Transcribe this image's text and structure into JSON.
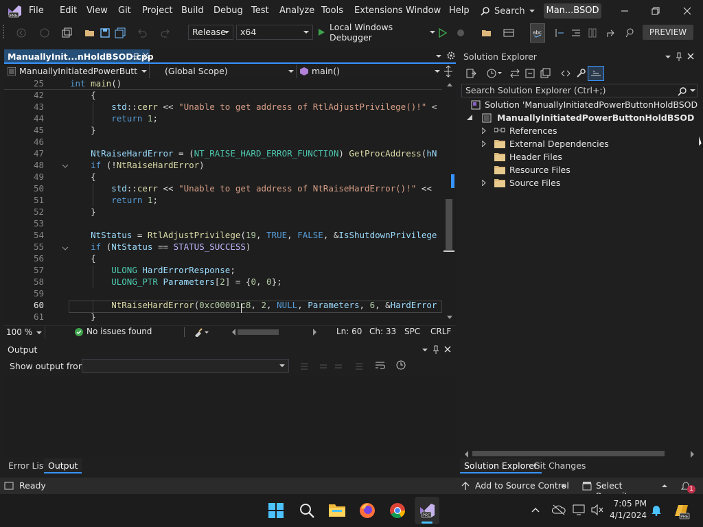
{
  "title": {
    "menu": [
      "File",
      "Edit",
      "View",
      "Git",
      "Project",
      "Build",
      "Debug",
      "Test",
      "Analyze",
      "Tools",
      "Extensions",
      "Window",
      "Help"
    ],
    "search_label": "Search",
    "solution_badge": "Man...BSOD"
  },
  "toolbar": {
    "config": "Release",
    "platform": "x64",
    "debugger": "Local Windows Debugger",
    "preview": "PREVIEW"
  },
  "editor": {
    "tab_label": "ManuallyInit...nHoldBSOD.cpp",
    "nav_project": "ManuallyInitiatedPowerButtonHo",
    "nav_scope": "(Global Scope)",
    "nav_function": "main()",
    "lines": [
      {
        "num": "25",
        "text": "int main()"
      },
      {
        "num": "42",
        "text": "    {"
      },
      {
        "num": "43",
        "text": "        std::cerr << \"Unable to get address of RtlAdjustPrivilege()!\" <"
      },
      {
        "num": "44",
        "text": "        return 1;"
      },
      {
        "num": "45",
        "text": "    }"
      },
      {
        "num": "46",
        "text": ""
      },
      {
        "num": "47",
        "text": "    NtRaiseHardError = (NT_RAISE_HARD_ERROR_FUNCTION) GetProcAddress(hN"
      },
      {
        "num": "48",
        "text": "    if (!NtRaiseHardError)"
      },
      {
        "num": "49",
        "text": "    {"
      },
      {
        "num": "50",
        "text": "        std::cerr << \"Unable to get address of NtRaiseHardError()!\" <<"
      },
      {
        "num": "51",
        "text": "        return 1;"
      },
      {
        "num": "52",
        "text": "    }"
      },
      {
        "num": "53",
        "text": ""
      },
      {
        "num": "54",
        "text": "    NtStatus = RtlAdjustPrivilege(19, TRUE, FALSE, &IsShutdownPrivilege"
      },
      {
        "num": "55",
        "text": "    if (NtStatus == STATUS_SUCCESS)"
      },
      {
        "num": "56",
        "text": "    {"
      },
      {
        "num": "57",
        "text": "        ULONG HardErrorResponse;"
      },
      {
        "num": "58",
        "text": "        ULONG_PTR Parameters[2] = {0, 0};"
      },
      {
        "num": "59",
        "text": ""
      },
      {
        "num": "60",
        "text": "        NtRaiseHardError(0xc00001c8, 2, NULL, Parameters, 6, &HardError"
      },
      {
        "num": "61",
        "text": "    }"
      }
    ],
    "zoom": "100 %",
    "issues": "No issues found",
    "ln": "Ln: 60",
    "ch": "Ch: 33",
    "spc": "SPC",
    "crlf": "CRLF"
  },
  "output": {
    "title": "Output",
    "show_from_label": "Show output from:",
    "show_from_value": ""
  },
  "bottom_tabs": [
    "Error List",
    "Output"
  ],
  "solution": {
    "title": "Solution Explorer",
    "search_placeholder": "Search Solution Explorer (Ctrl+;)",
    "solution_label": "Solution 'ManuallyInitiatedPowerButtonHoldBSOD' (1 of 1",
    "project": "ManuallyInitiatedPowerButtonHoldBSOD",
    "items": [
      {
        "label": "References",
        "expander": true
      },
      {
        "label": "External Dependencies",
        "expander": true
      },
      {
        "label": "Header Files",
        "expander": false
      },
      {
        "label": "Resource Files",
        "expander": false
      },
      {
        "label": "Source Files",
        "expander": true
      }
    ],
    "tabs": [
      "Solution Explorer",
      "Git Changes"
    ]
  },
  "statusbar": {
    "ready": "Ready",
    "source_control": "Add to Source Control",
    "repository": "Select Repository",
    "notifications": "1"
  },
  "taskbar": {
    "time": "7:05 PM",
    "date": "4/1/2024"
  },
  "colors": {
    "accent": "#3794ff",
    "vs_purple": "#8661c5",
    "green": "#3fa34d"
  }
}
